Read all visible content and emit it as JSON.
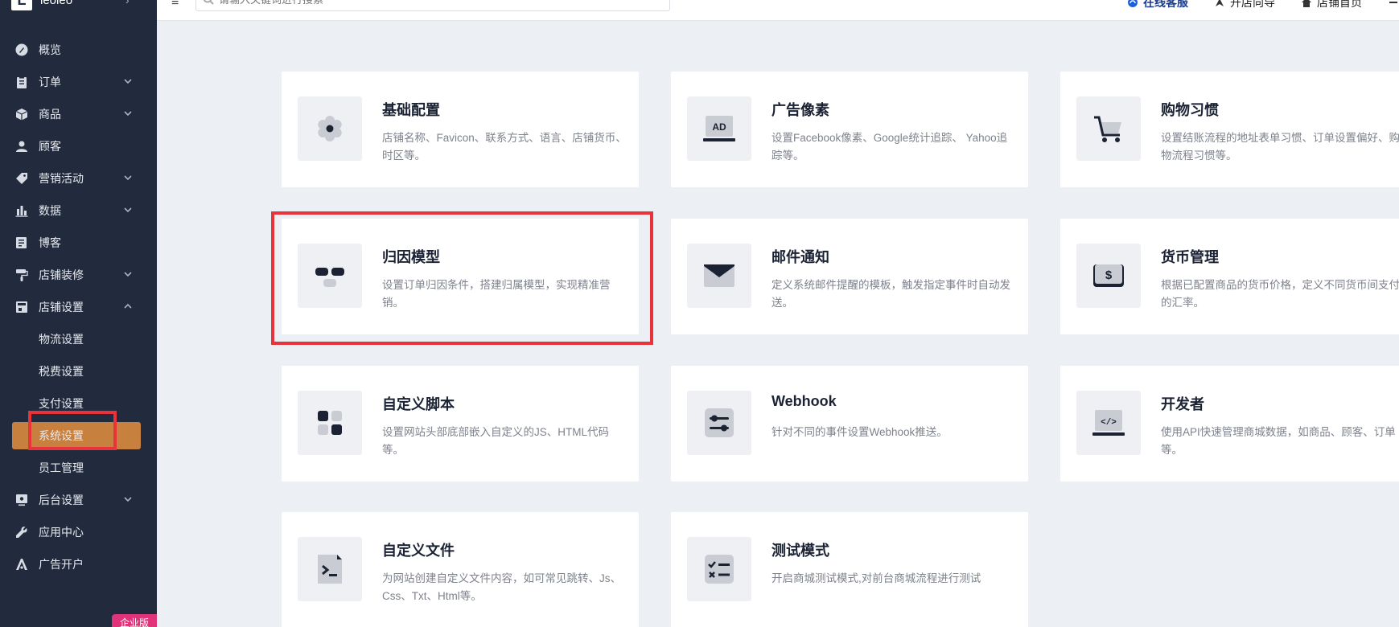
{
  "brand": {
    "logo": "L",
    "name": "leoleo"
  },
  "sidebar": {
    "items": [
      {
        "label": "概览",
        "icon": "dashboard-icon",
        "expandable": false
      },
      {
        "label": "订单",
        "icon": "clipboard-icon",
        "expandable": true
      },
      {
        "label": "商品",
        "icon": "box-icon",
        "expandable": true
      },
      {
        "label": "顾客",
        "icon": "user-icon",
        "expandable": false
      },
      {
        "label": "营销活动",
        "icon": "tag-icon",
        "expandable": true
      },
      {
        "label": "数据",
        "icon": "bar-chart-icon",
        "expandable": true
      },
      {
        "label": "博客",
        "icon": "blog-icon",
        "expandable": false
      },
      {
        "label": "店铺装修",
        "icon": "paint-roller-icon",
        "expandable": true
      },
      {
        "label": "店铺设置",
        "icon": "store-icon",
        "expandable": true,
        "expanded": true
      }
    ],
    "sub_items": [
      "物流设置",
      "税费设置",
      "支付设置",
      "系统设置",
      "员工管理"
    ],
    "active_sub": "系统设置",
    "bottom_items": [
      {
        "label": "后台设置",
        "icon": "monitor-icon",
        "expandable": true
      },
      {
        "label": "应用中心",
        "icon": "wrench-icon",
        "expandable": false
      },
      {
        "label": "广告开户",
        "icon": "ad-icon",
        "expandable": false
      }
    ],
    "edition": "企业版"
  },
  "topbar": {
    "search_placeholder": "请输入关键词进行搜索",
    "links": [
      "在线客服",
      "开店向导",
      "店铺首页"
    ]
  },
  "cards": [
    {
      "title": "基础配置",
      "desc": "店铺名称、Favicon、联系方式、语言、店铺货币、时区等。",
      "icon": "gear-icon"
    },
    {
      "title": "广告像素",
      "desc": "设置Facebook像素、Google统计追踪、 Yahoo追踪等。",
      "icon": "ad-laptop-icon"
    },
    {
      "title": "购物习惯",
      "desc": "设置结账流程的地址表单习惯、订单设置偏好、购物流程习惯等。",
      "icon": "cart-icon"
    },
    {
      "title": "归因模型",
      "desc": "设置订单归因条件，搭建归属模型，实现精准营销。",
      "icon": "attribution-icon"
    },
    {
      "title": "邮件通知",
      "desc": "定义系统邮件提醒的模板，触发指定事件时自动发送。",
      "icon": "mail-icon"
    },
    {
      "title": "货币管理",
      "desc": "根据已配置商品的货币价格，定义不同货币间支付的汇率。",
      "icon": "currency-icon"
    },
    {
      "title": "自定义脚本",
      "desc": "设置网站头部底部嵌入自定义的JS、HTML代码等。",
      "icon": "blocks-icon"
    },
    {
      "title": "Webhook",
      "desc": "针对不同的事件设置Webhook推送。",
      "icon": "sliders-icon"
    },
    {
      "title": "开发者",
      "desc": "使用API快速管理商城数据，如商品、顾客、订单等。",
      "icon": "code-laptop-icon"
    },
    {
      "title": "自定义文件",
      "desc": "为网站创建自定义文件内容，如可常见跳转、Js、Css、Txt、Html等。",
      "icon": "terminal-file-icon"
    },
    {
      "title": "测试模式",
      "desc": "开启商城测试模式,对前台商城流程进行测试",
      "icon": "checklist-icon"
    }
  ]
}
